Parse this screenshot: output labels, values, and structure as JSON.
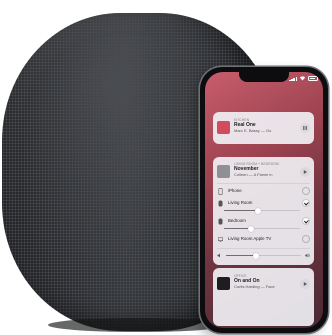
{
  "now_playing": {
    "cards": [
      {
        "room": "KITCHEN",
        "title": "Real One",
        "artist": "Marc E. Bassy — Go",
        "art_color": "#cf4d5e"
      },
      {
        "room": "LIVING ROOM + BEDROOM",
        "title": "November",
        "artist": "Colleen — A Flame in",
        "art_color": "#8f8f96",
        "devices": [
          {
            "label": "iPhone",
            "icon": "phone-icon",
            "selected": false,
            "has_slider": false,
            "level": null
          },
          {
            "label": "Living Room",
            "icon": "speaker-icon",
            "selected": true,
            "has_slider": true,
            "level": 0.45
          },
          {
            "label": "Bedroom",
            "icon": "speaker-icon",
            "selected": true,
            "has_slider": true,
            "level": 0.35
          },
          {
            "label": "Living Room Apple TV",
            "icon": "tv-icon",
            "selected": false,
            "has_slider": false,
            "level": null
          }
        ]
      },
      {
        "room": "OFFICE",
        "title": "On and On",
        "artist": "Curtis Harding — Face",
        "art_color": "#1e1e20"
      }
    ],
    "master_volume": 0.4
  },
  "colors": {
    "speaker_body": "#2c2e31",
    "screen_accent": "#c85d6c",
    "card_bg": "#f0f0f4"
  }
}
